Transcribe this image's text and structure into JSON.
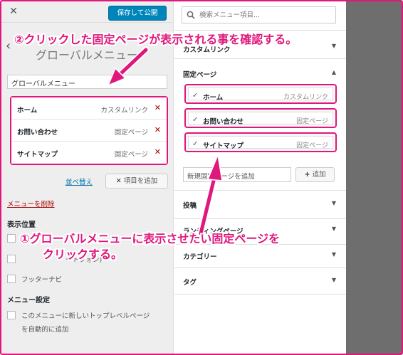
{
  "topbar": {
    "close_icon": "close-icon",
    "publish_label": "保存して公開"
  },
  "menu": {
    "heading": "グローバルメニュー",
    "name_value": "グローバルメニュー",
    "items": [
      {
        "title": "ホーム",
        "type": "カスタムリンク"
      },
      {
        "title": "お問い合わせ",
        "type": "固定ページ"
      },
      {
        "title": "サイトマップ",
        "type": "固定ページ"
      }
    ],
    "reorder_label": "並べ替え",
    "add_items_label": "項目を追加",
    "delete_label": "メニューを削除",
    "locations_heading": "表示位置",
    "locations": [
      {
        "label": ""
      },
      {
        "label": "ートフォン)"
      },
      {
        "label": "フッターナビ"
      }
    ],
    "settings_heading": "メニュー設定",
    "auto_add_label_1": "このメニューに新しいトップレベルページ",
    "auto_add_label_2": "を自動的に追加"
  },
  "search": {
    "placeholder": "検索メニュー項目..."
  },
  "panels": {
    "custom_links": "カスタムリンク",
    "pages": "固定ページ",
    "posts": "投稿",
    "landing": "ランディングページ",
    "categories": "カテゴリー",
    "tags": "タグ"
  },
  "pages": [
    {
      "title": "ホーム",
      "type": "カスタムリンク"
    },
    {
      "title": "お問い合わせ",
      "type": "固定ページ"
    },
    {
      "title": "サイトマップ",
      "type": "固定ページ"
    }
  ],
  "new_page": {
    "value": "新規固定ページを追加",
    "add_label": "追加"
  },
  "annotations": {
    "note2": "②クリックした固定ページが表示される事を確認する。",
    "note1_line1": "①グローバルメニューに表示させたい固定ページを",
    "note1_line2": "クリックする。"
  },
  "colors": {
    "accent": "#e0177c",
    "primary": "#0085ba",
    "dark_bg": "#6e6e6e"
  }
}
